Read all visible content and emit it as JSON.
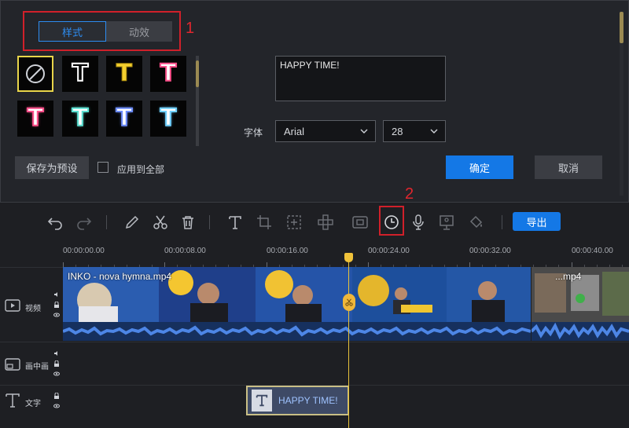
{
  "panel": {
    "tabs": [
      {
        "label": "样式",
        "active": true
      },
      {
        "label": "动效",
        "active": false
      }
    ],
    "annotation_1": "1",
    "presets": [
      {
        "name": "none"
      },
      {
        "name": "outline-white",
        "color": "#ffffff"
      },
      {
        "name": "yellow",
        "color": "#f4cf2e"
      },
      {
        "name": "white-bold",
        "color": "#ffffff"
      },
      {
        "name": "pink-glow",
        "color": "#ff4f8a"
      },
      {
        "name": "cyan-glow",
        "color": "#5de1d3"
      },
      {
        "name": "blue-glow",
        "color": "#6d8dff"
      },
      {
        "name": "lightblue-glow",
        "color": "#6fd0ff"
      }
    ],
    "text_value": "HAPPY TIME!",
    "font_label": "字体",
    "font_value": "Arial",
    "size_value": "28",
    "save_preset": "保存为预设",
    "apply_all": "应用到全部",
    "confirm": "确定",
    "cancel": "取消"
  },
  "toolbar": {
    "annotation_2": "2",
    "export": "导出"
  },
  "ruler": {
    "labels": [
      "00:00:00.00",
      "00:00:08.00",
      "00:00:16.00",
      "00:00:24.00",
      "00:00:32.00",
      "00:00:40.00"
    ]
  },
  "tracks": {
    "video": {
      "name": "视频",
      "clip_title": "INKO - nova hymna.mp4",
      "clip2_title": "...mp4"
    },
    "pip": {
      "name": "画中画"
    },
    "text": {
      "name": "文字",
      "clip_label": "HAPPY TIME!"
    }
  },
  "colors": {
    "accent": "#1478e6",
    "highlight": "#d0202a",
    "playhead": "#e8c23a"
  }
}
